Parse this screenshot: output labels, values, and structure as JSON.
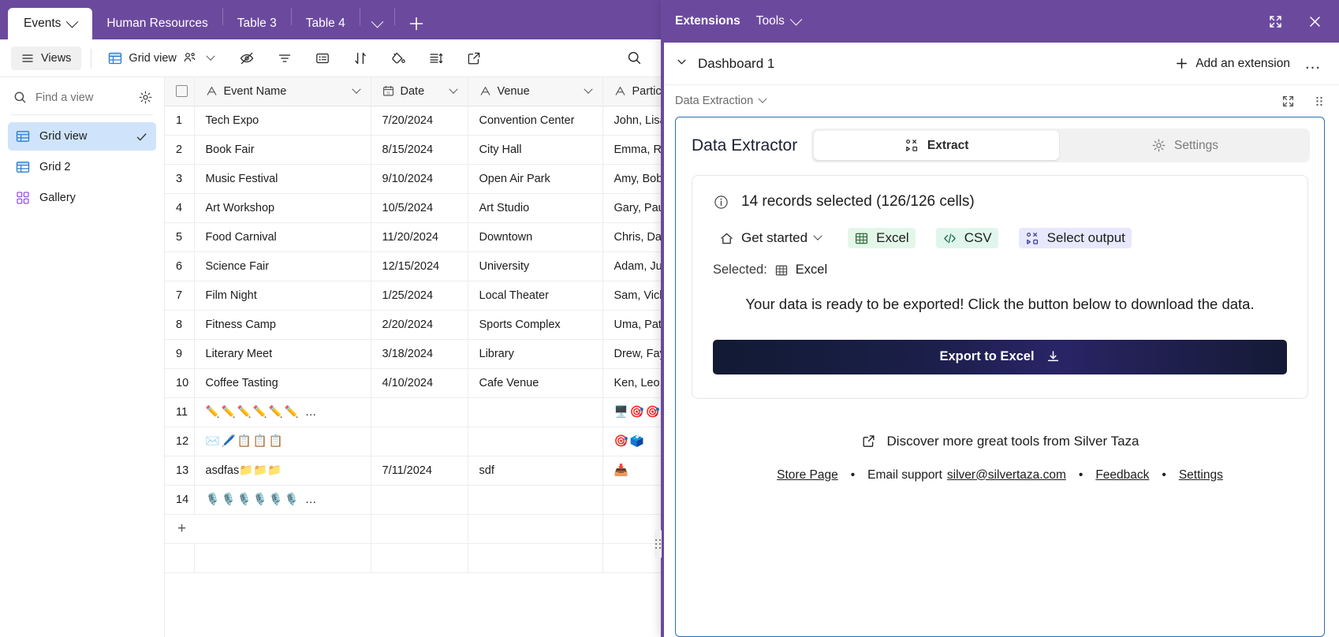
{
  "tabs": {
    "items": [
      {
        "label": "Events",
        "active": true,
        "has_chevron": true
      },
      {
        "label": "Human Resources",
        "active": false
      },
      {
        "label": "Table 3",
        "active": false
      },
      {
        "label": "Table 4",
        "active": false
      }
    ],
    "more_label": "more-tabs",
    "add_label": "add-table"
  },
  "toolbar": {
    "views_label": "Views",
    "grid_view_label": "Grid view",
    "icons": [
      {
        "name": "hide-fields-icon"
      },
      {
        "name": "filter-icon"
      },
      {
        "name": "group-icon"
      },
      {
        "name": "sort-icon"
      },
      {
        "name": "color-icon"
      },
      {
        "name": "row-height-icon"
      },
      {
        "name": "share-icon"
      }
    ],
    "search_label": "search"
  },
  "sidebar": {
    "search_placeholder": "Find a view",
    "settings_label": "view-settings",
    "items": [
      {
        "label": "Grid view",
        "icon": "grid-icon",
        "active": true,
        "checked": true
      },
      {
        "label": "Grid 2",
        "icon": "grid-icon",
        "active": false,
        "checked": false
      },
      {
        "label": "Gallery",
        "icon": "gallery-icon",
        "active": false,
        "checked": false
      }
    ]
  },
  "grid": {
    "columns": [
      {
        "label": "Event Name",
        "type_icon": "text-icon"
      },
      {
        "label": "Date",
        "type_icon": "calendar-icon"
      },
      {
        "label": "Venue",
        "type_icon": "text-icon"
      },
      {
        "label": "Participan",
        "type_icon": "text-icon"
      }
    ],
    "rows": [
      {
        "n": "1",
        "name": "Tech Expo",
        "date": "7/20/2024",
        "venue": "Convention Center",
        "participants": "John, Lisa, M"
      },
      {
        "n": "2",
        "name": "Book Fair",
        "date": "8/15/2024",
        "venue": "City Hall",
        "participants": "Emma, Ron,"
      },
      {
        "n": "3",
        "name": "Music Festival",
        "date": "9/10/2024",
        "venue": "Open Air Park",
        "participants": "Amy, Bob, Cl"
      },
      {
        "n": "4",
        "name": "Art Workshop",
        "date": "10/5/2024",
        "venue": "Art Studio",
        "participants": "Gary, Paula, "
      },
      {
        "n": "5",
        "name": "Food Carnival",
        "date": "11/20/2024",
        "venue": "Downtown",
        "participants": "Chris, Dana,"
      },
      {
        "n": "6",
        "name": "Science Fair",
        "date": "12/15/2024",
        "venue": "University",
        "participants": "Adam, Julia,"
      },
      {
        "n": "7",
        "name": "Film Night",
        "date": "1/25/2024",
        "venue": "Local Theater",
        "participants": "Sam, Vicki, F"
      },
      {
        "n": "8",
        "name": "Fitness Camp",
        "date": "2/20/2024",
        "venue": "Sports Complex",
        "participants": "Uma, Pat, Lo"
      },
      {
        "n": "9",
        "name": "Literary Meet",
        "date": "3/18/2024",
        "venue": "Library",
        "participants": "Drew, Faye, "
      },
      {
        "n": "10",
        "name": "Coffee Tasting",
        "date": "4/10/2024",
        "venue": "Cafe Venue",
        "participants": "Ken, Leo, Mi"
      },
      {
        "n": "11",
        "name": "✏️✏️✏️✏️✏️✏️ …",
        "date": "",
        "venue": "",
        "participants": "🖥️🎯🎯🎯"
      },
      {
        "n": "12",
        "name": "✉️🖊️📋📋📋",
        "date": "",
        "venue": "",
        "participants": "🎯🗳️"
      },
      {
        "n": "13",
        "name": "asdfas📁📁📁",
        "date": "7/11/2024",
        "venue": "sdf",
        "participants": "📥"
      },
      {
        "n": "14",
        "name": "🎙️🎙️🎙️🎙️🎙️🎙️ …",
        "date": "",
        "venue": "",
        "participants": ""
      }
    ],
    "add_row_label": "+"
  },
  "panel": {
    "title": "Extensions",
    "tools_label": "Tools",
    "expand_label": "expand-panel",
    "close_label": "close-panel",
    "dashboard_name": "Dashboard 1",
    "add_extension_label": "Add an extension",
    "more_label": "…",
    "extension_group_label": "Data Extraction",
    "fullscreen_label": "fullscreen",
    "grip_label": "drag-grip"
  },
  "extension": {
    "name": "Data Extractor",
    "tabs": [
      {
        "label": "Extract",
        "icon": "extract-icon",
        "active": true
      },
      {
        "label": "Settings",
        "icon": "gear-icon",
        "active": false
      }
    ],
    "records_status": "14 records selected (126/126 cells)",
    "format_menu": {
      "get_started": "Get started",
      "options": [
        {
          "label": "Excel",
          "icon": "table-icon",
          "style": "excel"
        },
        {
          "label": "CSV",
          "icon": "code-icon",
          "style": "csv"
        },
        {
          "label": "Select output",
          "icon": "extract-icon",
          "style": "output"
        }
      ]
    },
    "selected_prefix": "Selected:",
    "selected_value": "Excel",
    "ready_message": "Your data is ready to be exported! Click the button below to download the data.",
    "export_button": "Export to Excel",
    "discover_text": "Discover more great tools from Silver Taza",
    "footer": {
      "store_page": "Store Page",
      "bullet": "•",
      "email_support_prefix": "Email support",
      "email": "silver@silvertaza.com",
      "feedback": "Feedback",
      "settings": "Settings"
    }
  },
  "colors": {
    "brand_purple": "#6b4a9e",
    "accent_blue": "#2a6fb8",
    "sidebar_active": "#cfe4fa",
    "excel_green": "#e3f7e8",
    "csv_green": "#e0f6ec",
    "output_lilac": "#e7e8fb"
  }
}
